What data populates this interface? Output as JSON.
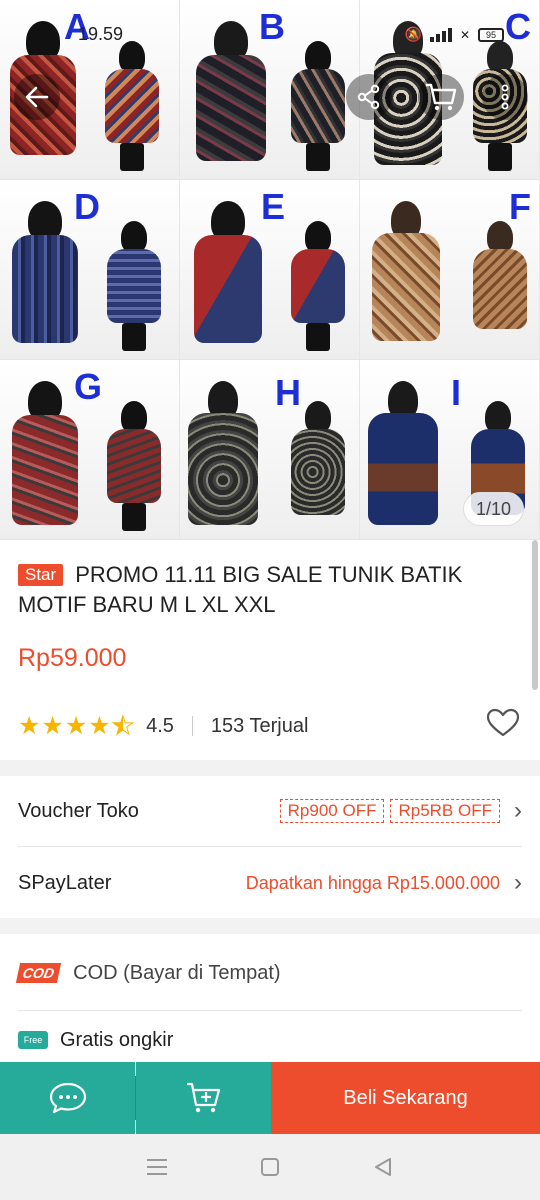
{
  "status_bar": {
    "time": "19.59",
    "battery": "95"
  },
  "gallery": {
    "letters": [
      "A",
      "B",
      "C",
      "D",
      "E",
      "F",
      "G",
      "H",
      "I"
    ],
    "page_indicator": "1/10"
  },
  "product": {
    "badge": "Star",
    "title": "PROMO 11.11 BIG SALE TUNIK BATIK MOTIF BARU M L XL XXL",
    "price": "Rp59.000",
    "rating": "4.5",
    "sold": "153 Terjual"
  },
  "voucher": {
    "label": "Voucher Toko",
    "tags": [
      "Rp900 OFF",
      "Rp5RB OFF"
    ]
  },
  "paylater": {
    "label": "SPayLater",
    "value": "Dapatkan hingga Rp15.000.000"
  },
  "cod": {
    "logo": "COD",
    "label": "COD (Bayar di Tempat)"
  },
  "shipping": {
    "badge": "Free",
    "label": "Gratis ongkir"
  },
  "actions": {
    "buy_label": "Beli Sekarang"
  },
  "colors": {
    "accent": "#ee4d2d",
    "teal": "#26aa99",
    "star": "#f7b500"
  },
  "icons": [
    "back-arrow-icon",
    "share-icon",
    "cart-icon",
    "more-vert-icon",
    "heart-icon",
    "chat-icon",
    "add-to-cart-icon",
    "menu-icon",
    "home-square-icon",
    "back-triangle-icon"
  ]
}
